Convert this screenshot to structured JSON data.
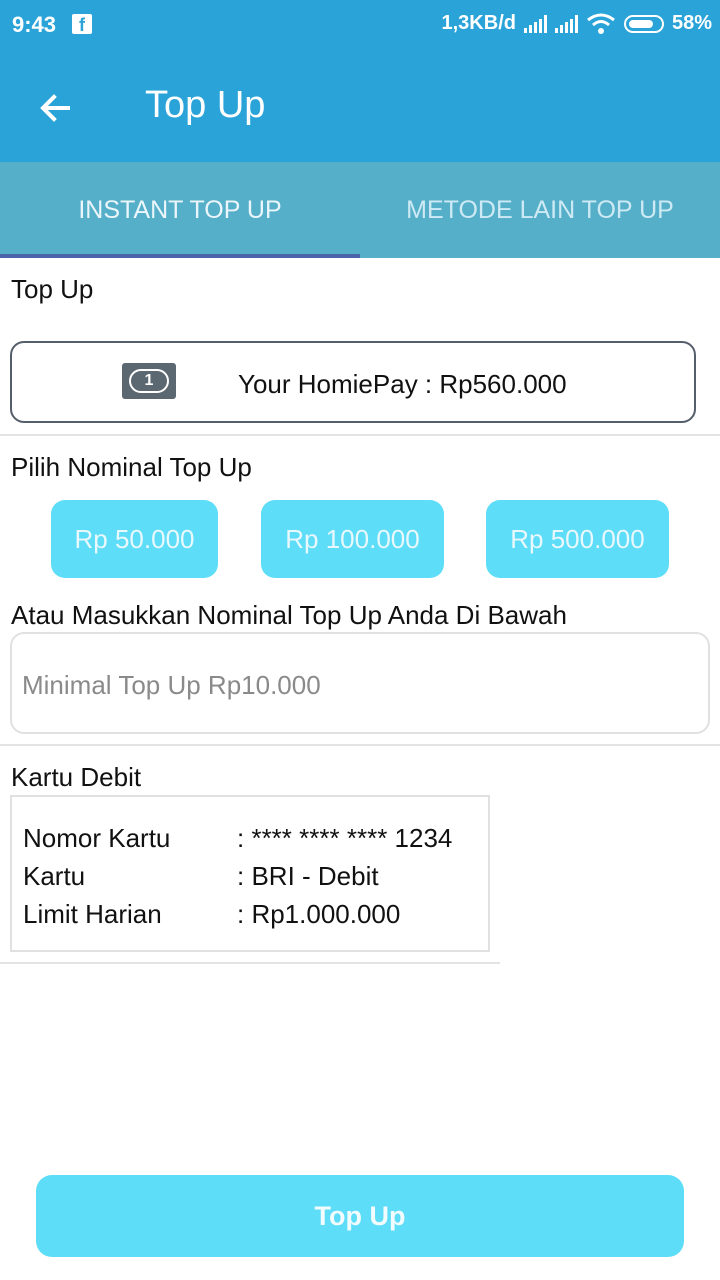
{
  "status_bar": {
    "time": "9:43",
    "notification_app": "f",
    "network_speed": "1,3KB/d",
    "battery": "58%"
  },
  "app_bar": {
    "title": "Top Up"
  },
  "tabs": [
    {
      "label": "INSTANT TOP UP",
      "selected": true
    },
    {
      "label": "METODE LAIN TOP UP",
      "selected": false
    }
  ],
  "top_up_section": {
    "label": "Top Up",
    "balance": "Your HomiePay : Rp560.000",
    "balance_icon": "1"
  },
  "nominal_section": {
    "label": "Pilih Nominal Top Up",
    "options": [
      "Rp 50.000",
      "Rp 100.000",
      "Rp 500.000"
    ]
  },
  "custom_amount": {
    "label": "Atau Masukkan Nominal Top Up Anda Di Bawah",
    "placeholder": "Minimal Top Up Rp10.000"
  },
  "debit_card": {
    "label": "Kartu Debit",
    "rows": [
      {
        "key": "Nomor Kartu",
        "value": ": **** **** **** 1234"
      },
      {
        "key": "Kartu",
        "value": ": BRI - Debit"
      },
      {
        "key": "Limit Harian",
        "value": ": Rp1.000.000"
      }
    ]
  },
  "submit_button": {
    "label": "Top Up"
  },
  "colors": {
    "primary": "#2aa3d9",
    "tab_bar": "#56afc9",
    "tab_indicator": "#4b63a8",
    "button": "#5dddf7"
  }
}
